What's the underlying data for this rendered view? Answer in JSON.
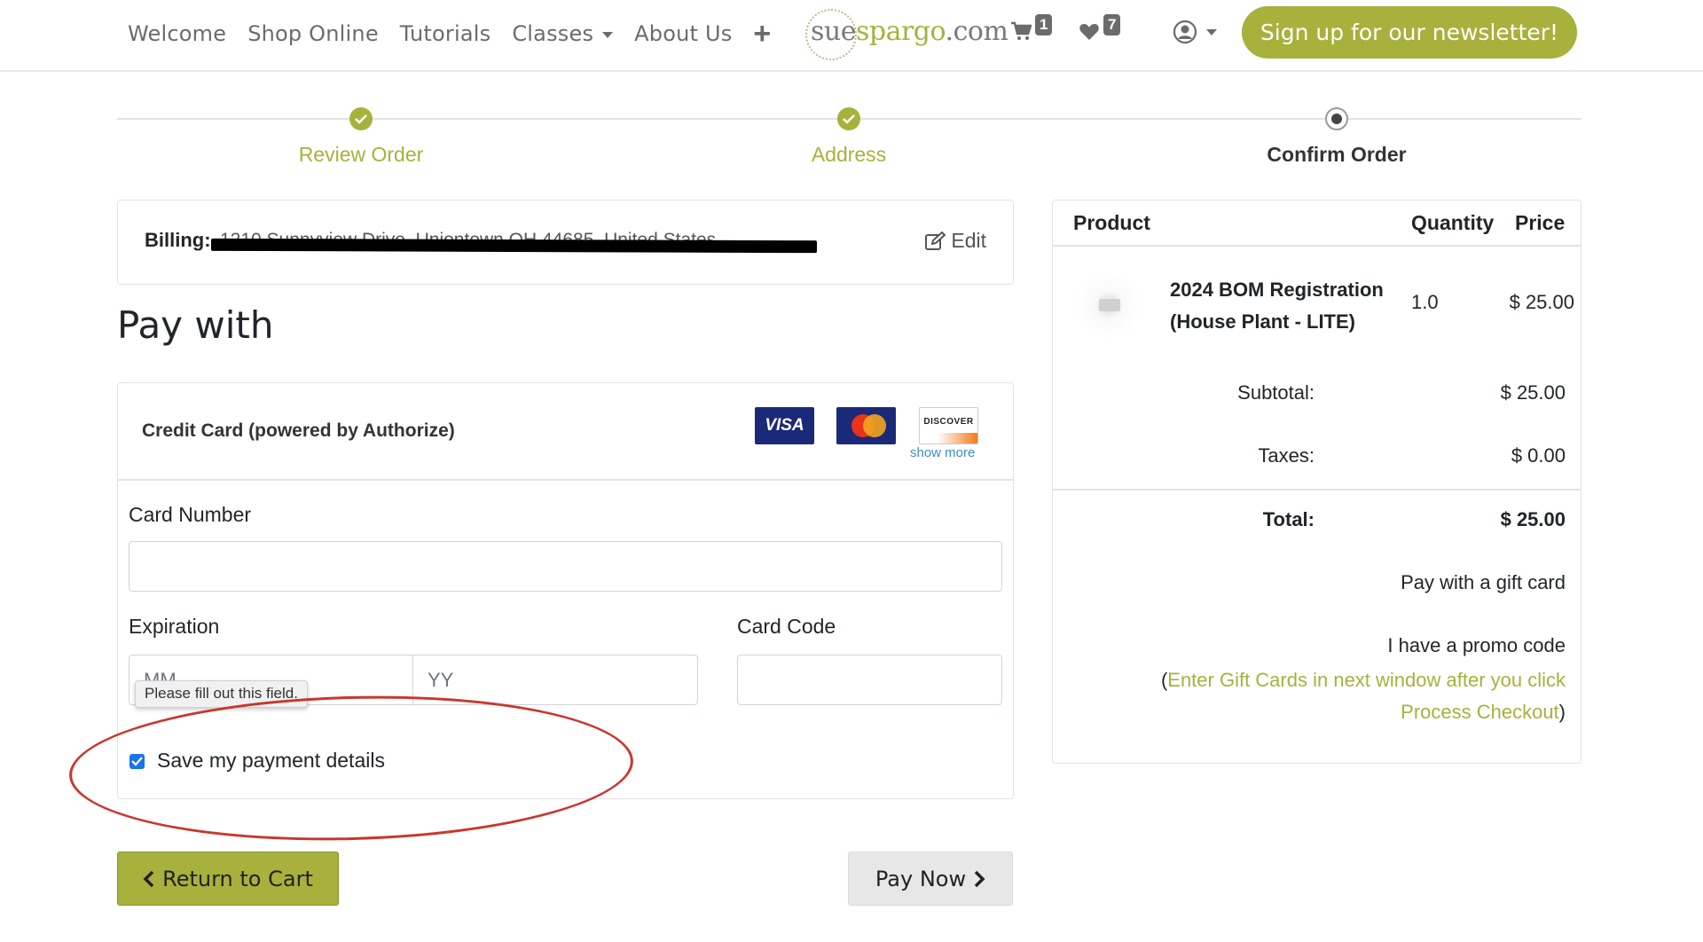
{
  "nav": {
    "links": [
      "Welcome",
      "Shop Online",
      "Tutorials",
      "Classes",
      "About Us"
    ],
    "plus": "+",
    "logo": {
      "part1": "sue",
      "part2": "spargo",
      "part3": ".com"
    },
    "cart_count": "1",
    "wishlist_count": "7",
    "newsletter_label": "Sign up for our newsletter!"
  },
  "steps": [
    {
      "label": "Review Order",
      "state": "done"
    },
    {
      "label": "Address",
      "state": "done"
    },
    {
      "label": "Confirm Order",
      "state": "current"
    }
  ],
  "billing": {
    "label": "Billing:",
    "value": "1210 Sunnyview Drive, Uniontown OH 44685, United States",
    "edit_label": "Edit"
  },
  "pay_with_title": "Pay with",
  "credit_card": {
    "title": "Credit Card (powered by Authorize)",
    "brands": {
      "visa": "VISA",
      "mastercard": "MasterCard",
      "discover": "DISCOVER"
    },
    "show_more": "show more",
    "card_number_label": "Card Number",
    "card_number_value": "",
    "expiration_label": "Expiration",
    "month_placeholder": "MM",
    "year_placeholder": "YY",
    "card_code_label": "Card Code",
    "card_code_value": "",
    "validation_tooltip": "Please fill out this field.",
    "save_label": "Save my payment details",
    "save_checked": true
  },
  "buttons": {
    "return_label": "Return to Cart",
    "pay_label": "Pay Now"
  },
  "summary": {
    "headers": {
      "product": "Product",
      "quantity": "Quantity",
      "price": "Price"
    },
    "item": {
      "name": "2024 BOM Registration (House Plant - LITE)",
      "quantity": "1.0",
      "price": "$ 25.00"
    },
    "subtotal_label": "Subtotal:",
    "subtotal_value": "$ 25.00",
    "taxes_label": "Taxes:",
    "taxes_value": "$ 0.00",
    "total_label": "Total:",
    "total_value": "$ 25.00",
    "gift_card_label": "Pay with a gift card",
    "promo_label": "I have a promo code",
    "promo_note_open": "(",
    "promo_note_link": "Enter Gift Cards in next window after you click Process Checkout",
    "promo_note_close": ")"
  },
  "colors": {
    "accent": "#a7b13c",
    "annotation": "#c8372d",
    "checkbox": "#1a73e8",
    "link_blue": "#3b8fc2"
  }
}
